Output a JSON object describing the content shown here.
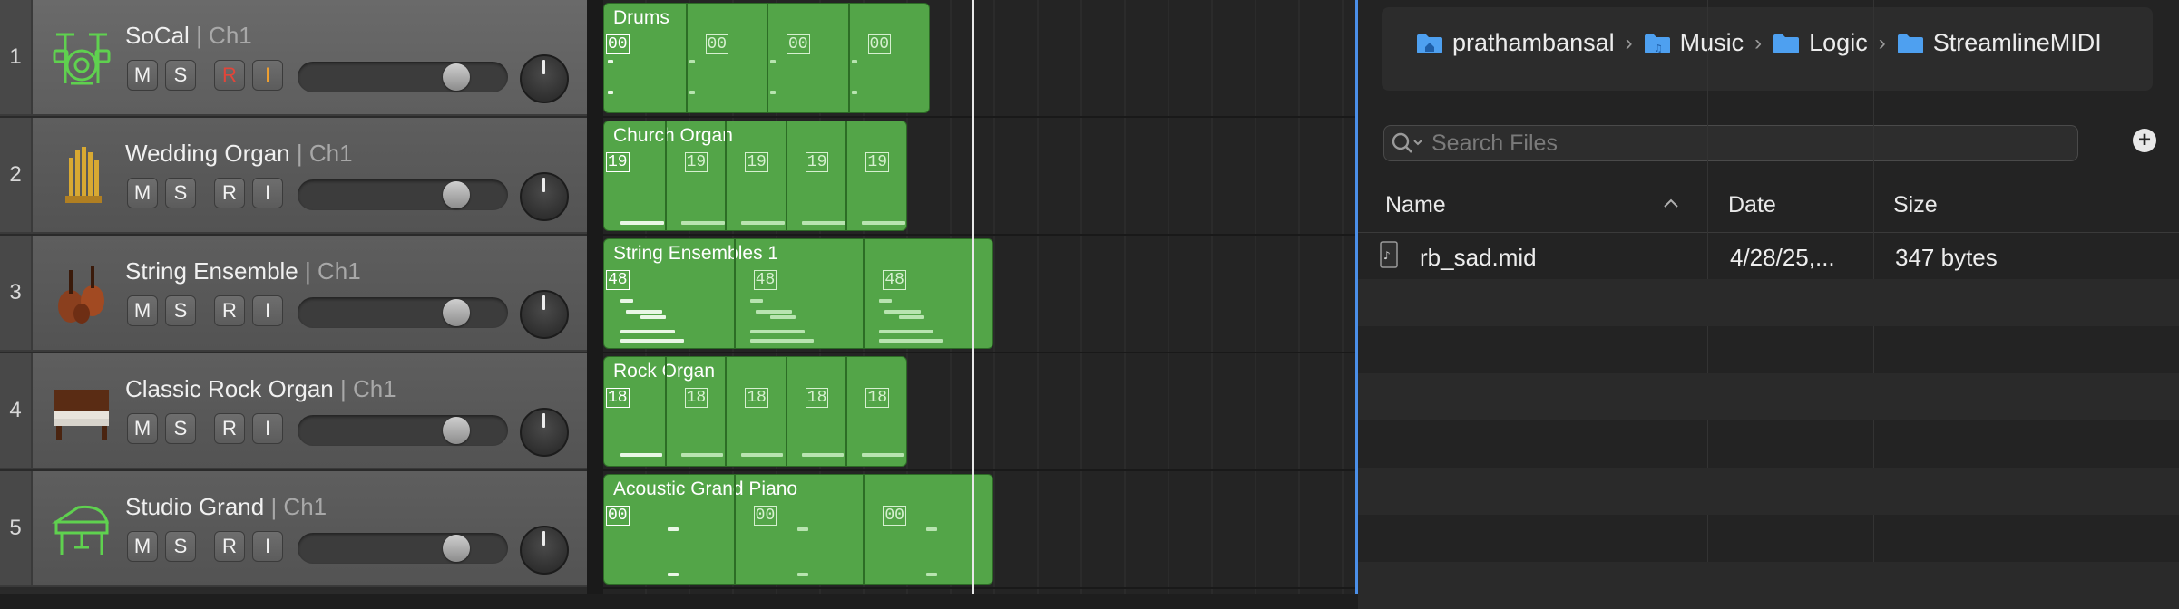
{
  "tracks": [
    {
      "number": "1",
      "name": "SoCal",
      "channel": "| Ch1",
      "icon": "drum-kit-icon",
      "mute": "M",
      "solo": "S",
      "record": "R",
      "input": "I",
      "armed": true,
      "volume": 0.8
    },
    {
      "number": "2",
      "name": "Wedding Organ",
      "channel": "| Ch1",
      "icon": "pipe-organ-icon",
      "mute": "M",
      "solo": "S",
      "record": "R",
      "input": "I",
      "armed": false,
      "volume": 0.8
    },
    {
      "number": "3",
      "name": "String Ensemble",
      "channel": "| Ch1",
      "icon": "strings-icon",
      "mute": "M",
      "solo": "S",
      "record": "R",
      "input": "I",
      "armed": false,
      "volume": 0.8
    },
    {
      "number": "4",
      "name": "Classic Rock Organ",
      "channel": "| Ch1",
      "icon": "organ-icon",
      "mute": "M",
      "solo": "S",
      "record": "R",
      "input": "I",
      "armed": false,
      "volume": 0.8
    },
    {
      "number": "5",
      "name": "Studio Grand",
      "channel": "| Ch1",
      "icon": "grand-piano-icon",
      "mute": "M",
      "solo": "S",
      "record": "R",
      "input": "I",
      "armed": false,
      "volume": 0.8
    }
  ],
  "regions": [
    {
      "name": "Drums",
      "loop_label": "00",
      "loops": 4
    },
    {
      "name": "Church Organ",
      "loop_label": "19",
      "loops": 5
    },
    {
      "name": "String Ensembles 1",
      "loop_label": "48",
      "loops": 3
    },
    {
      "name": "Rock Organ",
      "loop_label": "18",
      "loops": 5
    },
    {
      "name": "Acoustic Grand Piano",
      "loop_label": "00",
      "loops": 3
    }
  ],
  "browser": {
    "breadcrumbs": [
      "prathambansal",
      "Music",
      "Logic",
      "StreamlineMIDI"
    ],
    "breadcrumb_icons": [
      "home-folder-icon",
      "music-folder-icon",
      "folder-icon",
      "folder-icon"
    ],
    "search_placeholder": "Search Files",
    "columns": {
      "name": "Name",
      "date": "Date",
      "size": "Size",
      "sort_indicator": "^"
    },
    "files": [
      {
        "name": "rb_sad.mid",
        "date": "4/28/25,...",
        "size": "347 bytes",
        "icon": "midi-file-icon"
      }
    ]
  },
  "colors": {
    "region": "#53a548",
    "accent": "#4b8fe8",
    "record": "#e0463a",
    "input": "#f0a030"
  }
}
